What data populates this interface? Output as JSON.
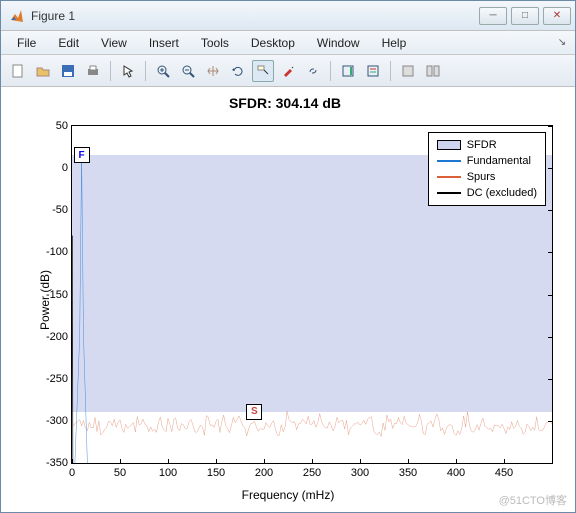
{
  "window": {
    "title": "Figure 1"
  },
  "menu": {
    "items": [
      "File",
      "Edit",
      "View",
      "Insert",
      "Tools",
      "Desktop",
      "Window",
      "Help"
    ]
  },
  "toolbar": {
    "groups": [
      [
        "new-file-icon",
        "open-file-icon",
        "save-icon",
        "print-icon"
      ],
      [
        "pointer-icon"
      ],
      [
        "zoom-in-icon",
        "zoom-out-icon",
        "pan-icon",
        "rotate-icon",
        "data-cursor-icon",
        "brush-icon",
        "link-icon"
      ],
      [
        "insert-colorbar-icon",
        "insert-legend-icon"
      ],
      [
        "screenshot-icon",
        "layout-icon"
      ]
    ]
  },
  "chart_data": {
    "type": "line",
    "title": "SFDR: 304.14 dB",
    "xlabel": "Frequency (mHz)",
    "ylabel": "Power (dB)",
    "xlim": [
      0,
      500
    ],
    "ylim": [
      -350,
      50
    ],
    "xticks": [
      0,
      50,
      100,
      150,
      200,
      250,
      300,
      350,
      400,
      450
    ],
    "yticks": [
      50,
      0,
      -50,
      -100,
      -150,
      -200,
      -250,
      -300,
      -350
    ],
    "sfdr_band": {
      "top_db": 15,
      "bottom_db": -289
    },
    "series": [
      {
        "name": "SFDR",
        "type": "patch",
        "color": "#ced4ee"
      },
      {
        "name": "Fundamental",
        "type": "line",
        "color": "#1f77d4"
      },
      {
        "name": "Spurs",
        "type": "line",
        "color": "#d9603b"
      },
      {
        "name": "DC (excluded)",
        "type": "line",
        "color": "#000000"
      }
    ],
    "fundamental_peak": {
      "x": 10,
      "y_db": 15,
      "label": "F"
    },
    "spur_marker": {
      "x": 190,
      "y_db": -289,
      "label": "S"
    },
    "spurs_floor_db": -305,
    "spurs_floor_jitter_db": 18
  },
  "watermark": "@51CTO博客"
}
